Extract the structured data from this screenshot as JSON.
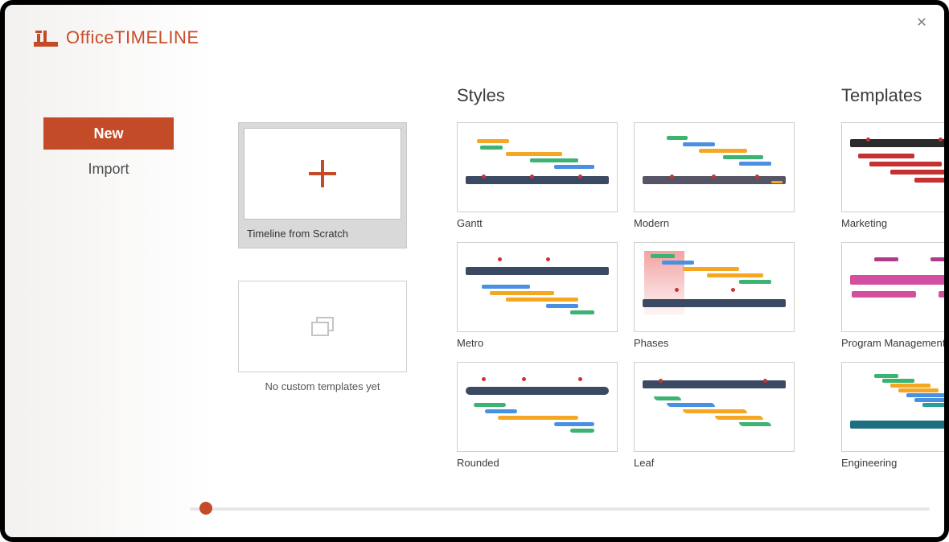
{
  "brand": {
    "part1": "Office",
    "part2": "TIMELINE"
  },
  "sidebar": {
    "items": [
      {
        "label": "New",
        "active": true
      },
      {
        "label": "Import",
        "active": false
      }
    ]
  },
  "sections": {
    "styles_title": "Styles",
    "templates_title": "Templates"
  },
  "scratch": {
    "label": "Timeline from Scratch"
  },
  "no_custom": {
    "label": "No custom templates yet"
  },
  "styles": [
    {
      "label": "Gantt"
    },
    {
      "label": "Modern"
    },
    {
      "label": "Metro"
    },
    {
      "label": "Phases"
    },
    {
      "label": "Rounded"
    },
    {
      "label": "Leaf"
    }
  ],
  "templates": [
    {
      "label": "Marketing"
    },
    {
      "label": "Program Management"
    },
    {
      "label": "Engineering"
    }
  ],
  "colors": {
    "accent": "#c44b27"
  }
}
